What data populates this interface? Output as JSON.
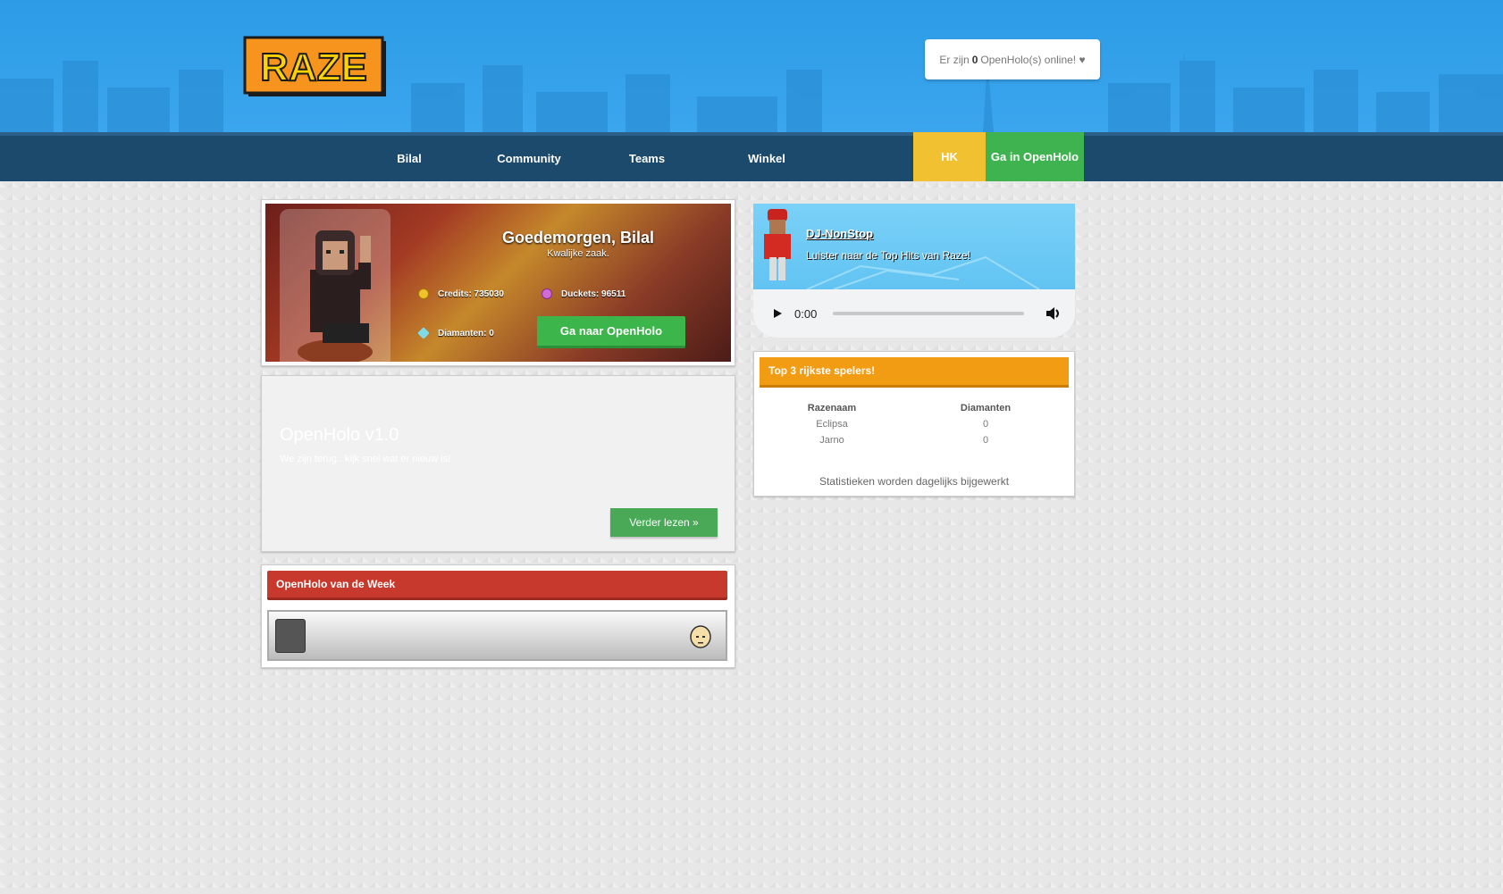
{
  "header": {
    "logo_text": "RAZE",
    "online": {
      "prefix": "Er zijn",
      "count": "0",
      "suffix": "OpenHolo(s) online! ♥"
    }
  },
  "nav": {
    "items": [
      "Bilal",
      "Community",
      "Teams",
      "Winkel"
    ],
    "hk": "HK",
    "go": "Ga in OpenHolo"
  },
  "profile": {
    "greeting": "Goedemorgen, Bilal",
    "motto": "Kwalijke zaak.",
    "credits": "Credits: 735030",
    "duckets": "Duckets: 96511",
    "diamonds": "Diamanten: 0",
    "button": "Ga naar OpenHolo"
  },
  "news": {
    "title": "OpenHolo v1.0",
    "subtitle": "We zijn terug.. kijk snel wat er nieuw is!",
    "read_more": "Verder lezen »"
  },
  "week": {
    "title": "OpenHolo van de Week"
  },
  "radio": {
    "dj": "DJ-NonStop",
    "subtitle": "Luister naar de Top Hits van Raze!",
    "time": "0:00"
  },
  "top3": {
    "title": "Top 3 rijkste spelers!",
    "columns": [
      "Razenaam",
      "Diamanten"
    ],
    "rows": [
      {
        "name": "Eclipsa",
        "value": "0"
      },
      {
        "name": "Jarno",
        "value": "0"
      }
    ],
    "footer": "Statistieken worden dagelijks bijgewerkt"
  }
}
